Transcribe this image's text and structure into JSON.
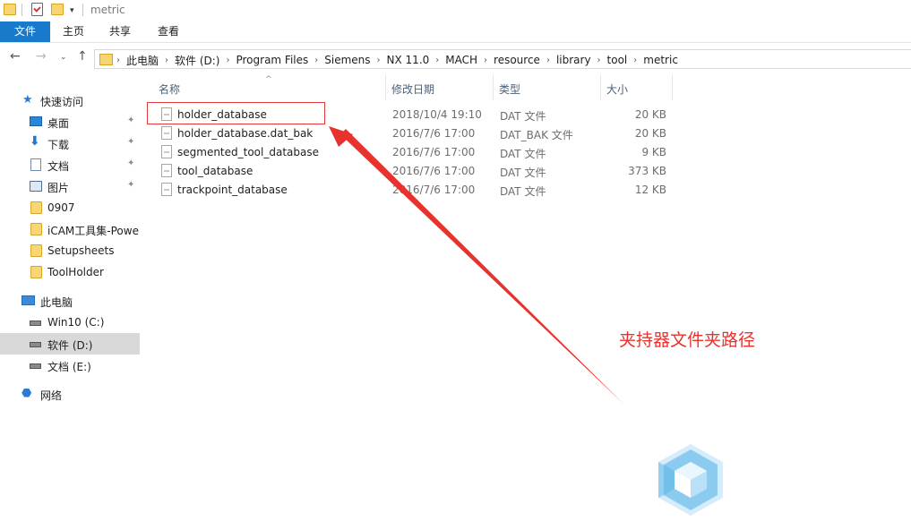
{
  "window": {
    "title": "metric"
  },
  "ribbon": {
    "tabs": [
      "文件",
      "主页",
      "共享",
      "查看"
    ]
  },
  "address_bar": {
    "path": [
      "此电脑",
      "软件 (D:)",
      "Program Files",
      "Siemens",
      "NX 11.0",
      "MACH",
      "resource",
      "library",
      "tool",
      "metric"
    ]
  },
  "nav_pane": {
    "quick_access": "快速访问",
    "pinned": [
      "桌面",
      "下载",
      "文档",
      "图片"
    ],
    "folders": [
      "0907",
      "iCAM工具集-Powe",
      "Setupsheets",
      "ToolHolder"
    ],
    "this_pc": "此电脑",
    "drives": [
      "Win10 (C:)",
      "软件 (D:)",
      "文档 (E:)"
    ],
    "network": "网络"
  },
  "file_list": {
    "columns": [
      "名称",
      "修改日期",
      "类型",
      "大小"
    ],
    "rows": [
      {
        "name": "holder_database",
        "date": "2018/10/4 19:10",
        "type": "DAT 文件",
        "size": "20 KB"
      },
      {
        "name": "holder_database.dat_bak",
        "date": "2016/7/6 17:00",
        "type": "DAT_BAK 文件",
        "size": "20 KB"
      },
      {
        "name": "segmented_tool_database",
        "date": "2016/7/6 17:00",
        "type": "DAT 文件",
        "size": "9 KB"
      },
      {
        "name": "tool_database",
        "date": "2016/7/6 17:00",
        "type": "DAT 文件",
        "size": "373 KB"
      },
      {
        "name": "trackpoint_database",
        "date": "2016/7/6 17:00",
        "type": "DAT 文件",
        "size": "12 KB"
      }
    ]
  },
  "annotation": {
    "text": "夹持器文件夹路径",
    "color": "#e8322d"
  },
  "colors": {
    "accent": "#1979ca",
    "selection": "#d9d9d9"
  }
}
